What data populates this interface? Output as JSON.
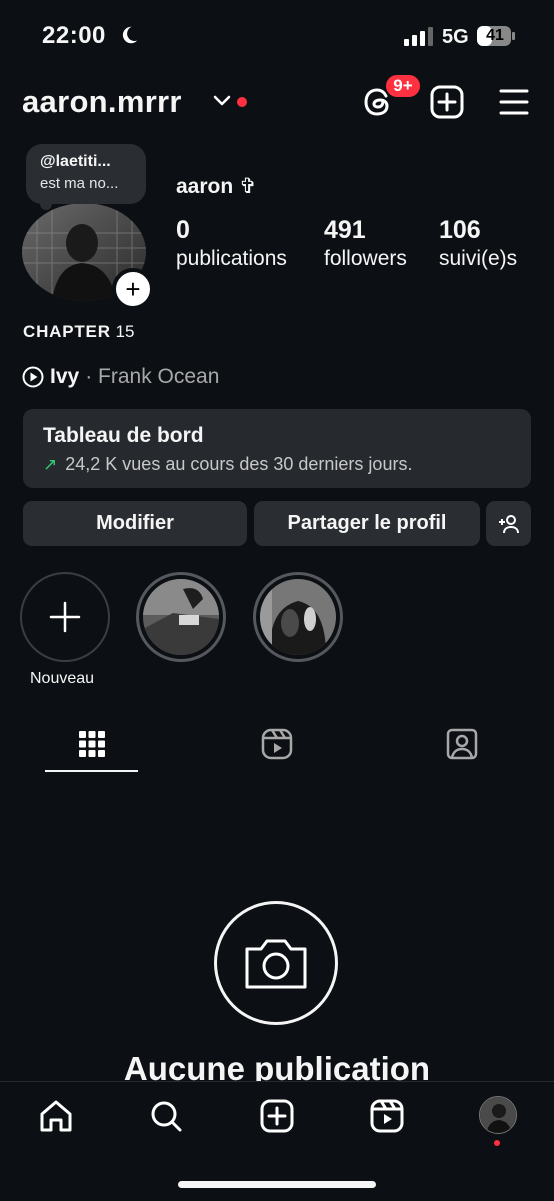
{
  "status_bar": {
    "time": "22:00",
    "network": "5G",
    "battery": "41"
  },
  "header": {
    "username": "aaron.mrrr",
    "threads_badge": "9+"
  },
  "profile": {
    "note_line1": "@laetiti...",
    "note_line2": "est ma no...",
    "full_name": "aaron ✞",
    "stats": [
      {
        "value": "0",
        "label": "publications"
      },
      {
        "value": "491",
        "label": "followers"
      },
      {
        "value": "106",
        "label": "suivi(e)s"
      }
    ],
    "bio_word": "CHAPTER",
    "bio_number": "15",
    "music": {
      "song": "Ivy",
      "artist": "· Frank Ocean"
    }
  },
  "dashboard": {
    "title": "Tableau de bord",
    "subtitle": "24,2 K vues au cours des 30 derniers jours."
  },
  "buttons": {
    "edit": "Modifier",
    "share": "Partager le profil"
  },
  "stories": {
    "new_label": "Nouveau"
  },
  "empty_state": {
    "title": "Aucune publication"
  },
  "colors": {
    "background": "#0c1014",
    "accent_red": "#ff3040",
    "surface": "#2a2e33",
    "trend_green": "#2fcc71"
  }
}
